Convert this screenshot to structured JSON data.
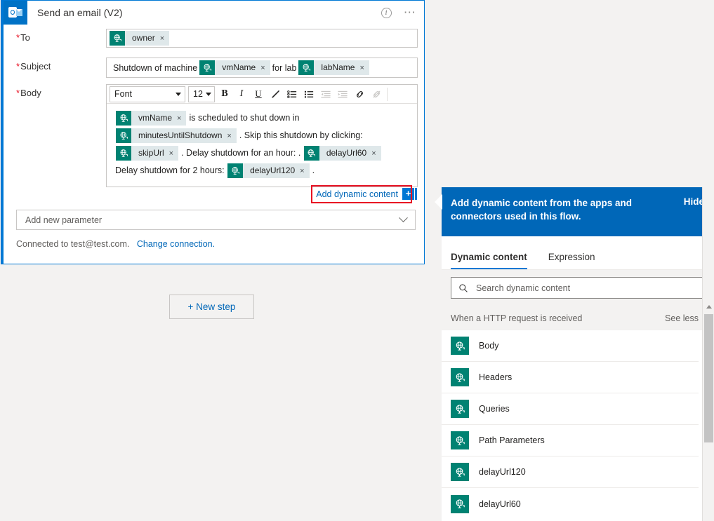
{
  "card": {
    "app_icon": "outlook-icon",
    "title": "Send an email (V2)",
    "info_icon": "info-icon",
    "more_icon": "more-options-icon",
    "fields": {
      "to": {
        "label": "To",
        "required_marker": "*",
        "tokens": [
          {
            "label": "owner",
            "remove": "×",
            "icon": "dynamic-content-icon"
          }
        ]
      },
      "subject": {
        "label": "Subject",
        "required_marker": "*",
        "parts": [
          {
            "kind": "text",
            "value": "Shutdown of machine"
          },
          {
            "kind": "token",
            "value": "vmName",
            "remove": "×",
            "icon": "dynamic-content-icon"
          },
          {
            "kind": "text",
            "value": "for lab"
          },
          {
            "kind": "token",
            "value": "labName",
            "remove": "×",
            "icon": "dynamic-content-icon"
          }
        ]
      },
      "body": {
        "label": "Body",
        "required_marker": "*",
        "toolbar": {
          "font_name": "Font",
          "font_size": "12",
          "buttons": [
            {
              "name": "bold-icon",
              "glyph": "B",
              "disabled": false
            },
            {
              "name": "italic-icon",
              "glyph": "I",
              "disabled": false
            },
            {
              "name": "underline-icon",
              "glyph": "U",
              "disabled": false
            },
            {
              "name": "text-highlight-icon",
              "glyph": "✐",
              "disabled": false
            },
            {
              "name": "numbered-list-icon",
              "glyph": "≡",
              "disabled": false
            },
            {
              "name": "bulleted-list-icon",
              "glyph": "≡",
              "disabled": false
            },
            {
              "name": "decrease-indent-icon",
              "glyph": "≡",
              "disabled": true
            },
            {
              "name": "increase-indent-icon",
              "glyph": "≡",
              "disabled": true
            },
            {
              "name": "insert-link-icon",
              "glyph": "⚭",
              "disabled": false
            },
            {
              "name": "remove-link-icon",
              "glyph": "⚭",
              "disabled": true
            }
          ]
        },
        "parts": [
          {
            "kind": "token",
            "value": "vmName",
            "remove": "×",
            "icon": "dynamic-content-icon"
          },
          {
            "kind": "text",
            "value": "is scheduled to shut down in"
          },
          {
            "kind": "token",
            "value": "minutesUntilShutdown",
            "remove": "×",
            "icon": "dynamic-content-icon"
          },
          {
            "kind": "text",
            "value": ". Skip this shutdown by clicking:"
          },
          {
            "kind": "token",
            "value": "skipUrl",
            "remove": "×",
            "icon": "dynamic-content-icon"
          },
          {
            "kind": "text",
            "value": ". Delay shutdown for an hour: ."
          },
          {
            "kind": "token",
            "value": "delayUrl60",
            "remove": "×",
            "icon": "dynamic-content-icon"
          },
          {
            "kind": "text",
            "value": "Delay shutdown for 2 hours:"
          },
          {
            "kind": "token",
            "value": "delayUrl120",
            "remove": "×",
            "icon": "dynamic-content-icon"
          },
          {
            "kind": "text",
            "value": "."
          }
        ]
      }
    },
    "add_dynamic_content": {
      "link_label": "Add dynamic content",
      "plus_label": "+",
      "highlight_color": "#e81123"
    },
    "add_new_parameter": {
      "label": "Add new parameter",
      "chevron": "chevron-down-icon"
    },
    "connection": {
      "text": "Connected to test@test.com.",
      "change_link": "Change connection."
    }
  },
  "canvas": {
    "new_step_label": "+ New step"
  },
  "flyout": {
    "header_text": "Add dynamic content from the apps and connectors used in this flow.",
    "hide_label": "Hide",
    "tabs": [
      {
        "label": "Dynamic content",
        "active": true
      },
      {
        "label": "Expression",
        "active": false
      }
    ],
    "search": {
      "placeholder": "Search dynamic content",
      "icon": "search-icon",
      "value": ""
    },
    "group": {
      "title": "When a HTTP request is received",
      "toggle_label": "See less"
    },
    "items": [
      {
        "label": "Body",
        "icon": "dynamic-content-icon"
      },
      {
        "label": "Headers",
        "icon": "dynamic-content-icon"
      },
      {
        "label": "Queries",
        "icon": "dynamic-content-icon"
      },
      {
        "label": "Path Parameters",
        "icon": "dynamic-content-icon"
      },
      {
        "label": "delayUrl120",
        "icon": "dynamic-content-icon"
      },
      {
        "label": "delayUrl60",
        "icon": "dynamic-content-icon"
      }
    ],
    "scrollbar": {
      "up_arrow": "scroll-up-icon"
    }
  },
  "colors": {
    "accent_blue": "#0078d4",
    "panel_blue": "#0067b8",
    "token_teal": "#008272",
    "token_label_bg": "#dfe8ea",
    "required_red": "#e81123",
    "link_blue": "#0067b8",
    "outlook_blue": "#0072c6"
  }
}
